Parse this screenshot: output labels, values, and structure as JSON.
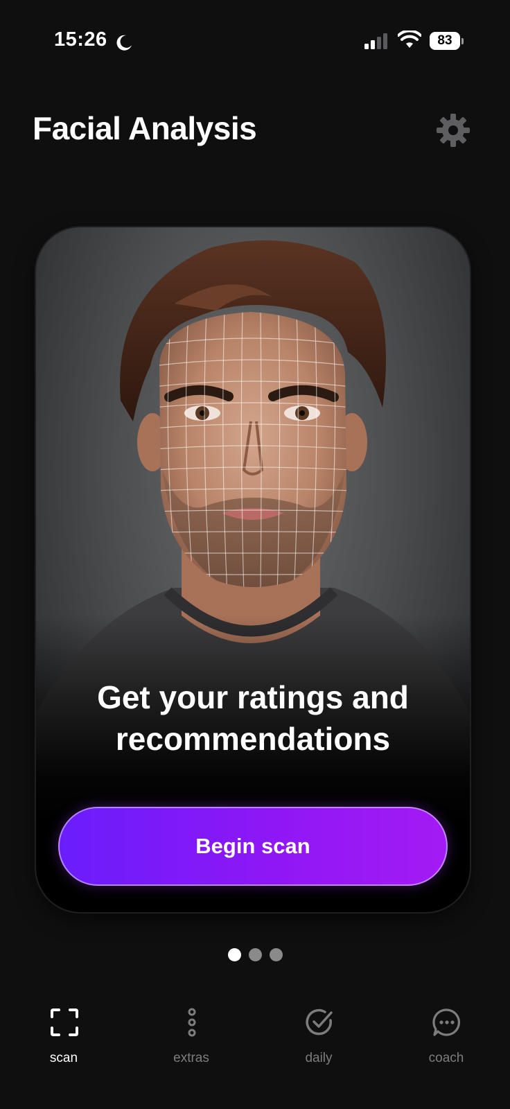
{
  "status_bar": {
    "time": "15:26",
    "battery": "83",
    "icons": [
      "moon-icon",
      "signal-icon",
      "wifi-icon",
      "battery-icon"
    ]
  },
  "header": {
    "title": "Facial Analysis",
    "settings_icon": "gear-icon"
  },
  "hero": {
    "headline_line1": "Get your ratings and",
    "headline_line2": "recommendations",
    "cta_label": "Begin scan",
    "cta_gradient": [
      "#6a1dfc",
      "#a31bf4"
    ]
  },
  "pagination": {
    "total": 3,
    "current": 1
  },
  "nav": {
    "items": [
      {
        "label": "scan",
        "icon": "scan-frame-icon",
        "active": true
      },
      {
        "label": "extras",
        "icon": "vertical-dots-icon",
        "active": false
      },
      {
        "label": "daily",
        "icon": "check-circle-icon",
        "active": false
      },
      {
        "label": "coach",
        "icon": "chat-bubble-icon",
        "active": false
      }
    ]
  },
  "colors": {
    "background": "#0f0f10",
    "accent": "#8f17f5",
    "nav_inactive": "#7d7d80"
  }
}
